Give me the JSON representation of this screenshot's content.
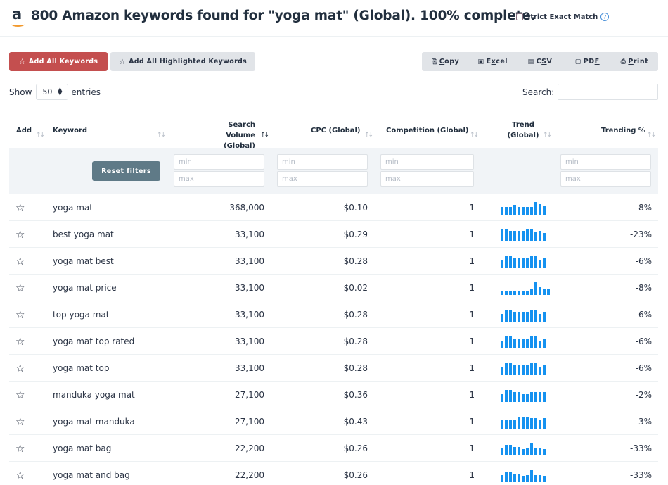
{
  "header": {
    "logo_icon": "amazon-logo-icon",
    "title": "800 Amazon keywords found for \"yoga mat\" (Global). 100% complete.",
    "strict_exact_match_label": "Strict Exact Match",
    "strict_exact_match_checked": false,
    "help_icon": "question-circle-icon",
    "help_glyph": "?"
  },
  "actions": {
    "add_all_label": "Add All Keywords",
    "add_highlighted_label": "Add All Highlighted Keywords",
    "star_glyph": "☆"
  },
  "export": {
    "buttons": [
      {
        "icon": "copy-icon",
        "glyph": "⎘",
        "pre": "",
        "u": "C",
        "post": "opy"
      },
      {
        "icon": "excel-file-icon",
        "glyph": "▣",
        "pre": "E",
        "u": "x",
        "post": "cel"
      },
      {
        "icon": "csv-file-icon",
        "glyph": "▤",
        "pre": "C",
        "u": "S",
        "post": "V"
      },
      {
        "icon": "pdf-file-icon",
        "glyph": "▢",
        "pre": "PD",
        "u": "F",
        "post": ""
      },
      {
        "icon": "print-icon",
        "glyph": "⎙",
        "pre": "",
        "u": "P",
        "post": "rint"
      }
    ]
  },
  "length": {
    "show_label": "Show",
    "value": "50",
    "entries_label": "entries"
  },
  "search": {
    "label": "Search:",
    "value": ""
  },
  "table": {
    "columns": {
      "add": "Add",
      "keyword": "Keyword",
      "volume_l1": "Search Volume",
      "volume_l2": "(Global)",
      "cpc": "CPC (Global)",
      "competition": "Competition (Global)",
      "trend_l1": "Trend",
      "trend_l2": "(Global)",
      "trending": "Trending %"
    },
    "sort_glyph": "↑↓",
    "filters": {
      "reset_label": "Reset filters",
      "min_placeholder": "min",
      "max_placeholder": "max"
    },
    "rows": [
      {
        "keyword": "yoga mat",
        "volume": "368,000",
        "cpc": "$0.10",
        "competition": "1",
        "trending": "-8%",
        "trend": [
          0.62,
          0.62,
          0.62,
          0.75,
          0.62,
          0.62,
          0.62,
          0.62,
          1.0,
          0.82,
          0.68,
          0.0
        ]
      },
      {
        "keyword": "best yoga mat",
        "volume": "33,100",
        "cpc": "$0.29",
        "competition": "1",
        "trending": "-23%",
        "trend": [
          1.0,
          1.0,
          0.85,
          0.85,
          0.85,
          0.85,
          1.0,
          1.0,
          0.7,
          0.82,
          0.65,
          0.0
        ]
      },
      {
        "keyword": "yoga mat best",
        "volume": "33,100",
        "cpc": "$0.28",
        "competition": "1",
        "trending": "-6%",
        "trend": [
          0.62,
          0.95,
          0.95,
          0.8,
          0.8,
          0.8,
          0.8,
          0.95,
          0.95,
          0.62,
          0.8,
          0.0
        ]
      },
      {
        "keyword": "yoga mat price",
        "volume": "33,100",
        "cpc": "$0.02",
        "competition": "1",
        "trending": "-8%",
        "trend": [
          0.33,
          0.29,
          0.33,
          0.33,
          0.33,
          0.33,
          0.33,
          0.43,
          1.0,
          0.62,
          0.52,
          0.43
        ]
      },
      {
        "keyword": "top yoga mat",
        "volume": "33,100",
        "cpc": "$0.28",
        "competition": "1",
        "trending": "-6%",
        "trend": [
          0.62,
          0.95,
          0.95,
          0.8,
          0.8,
          0.8,
          0.8,
          0.95,
          0.95,
          0.62,
          0.8,
          0.0
        ]
      },
      {
        "keyword": "yoga mat top rated",
        "volume": "33,100",
        "cpc": "$0.28",
        "competition": "1",
        "trending": "-6%",
        "trend": [
          0.62,
          0.95,
          0.95,
          0.8,
          0.8,
          0.8,
          0.8,
          0.95,
          0.95,
          0.62,
          0.8,
          0.0
        ]
      },
      {
        "keyword": "yoga mat top",
        "volume": "33,100",
        "cpc": "$0.28",
        "competition": "1",
        "trending": "-6%",
        "trend": [
          0.62,
          0.95,
          0.95,
          0.8,
          0.8,
          0.8,
          0.8,
          0.95,
          0.95,
          0.62,
          0.8,
          0.0
        ]
      },
      {
        "keyword": "manduka yoga mat",
        "volume": "27,100",
        "cpc": "$0.36",
        "competition": "1",
        "trending": "-2%",
        "trend": [
          0.62,
          0.95,
          0.95,
          0.78,
          0.78,
          0.62,
          0.62,
          0.78,
          0.78,
          0.78,
          0.78,
          0.0
        ]
      },
      {
        "keyword": "yoga mat manduka",
        "volume": "27,100",
        "cpc": "$0.43",
        "competition": "1",
        "trending": "3%",
        "trend": [
          0.65,
          0.65,
          0.65,
          0.65,
          0.97,
          0.97,
          0.97,
          0.85,
          0.85,
          0.65,
          0.85,
          0.0
        ]
      },
      {
        "keyword": "yoga mat bag",
        "volume": "22,200",
        "cpc": "$0.26",
        "competition": "1",
        "trending": "-33%",
        "trend": [
          0.55,
          0.85,
          0.85,
          0.65,
          0.65,
          0.48,
          0.55,
          1.0,
          0.55,
          0.55,
          0.48,
          0.0
        ]
      },
      {
        "keyword": "yoga mat and bag",
        "volume": "22,200",
        "cpc": "$0.26",
        "competition": "1",
        "trending": "-33%",
        "trend": [
          0.55,
          0.85,
          0.85,
          0.65,
          0.65,
          0.48,
          0.55,
          1.0,
          0.55,
          0.55,
          0.48,
          0.0
        ]
      }
    ]
  },
  "colors": {
    "primary_red": "#c44f4f",
    "reset_button": "#5f7a87",
    "trend_bar": "#1592f0"
  }
}
